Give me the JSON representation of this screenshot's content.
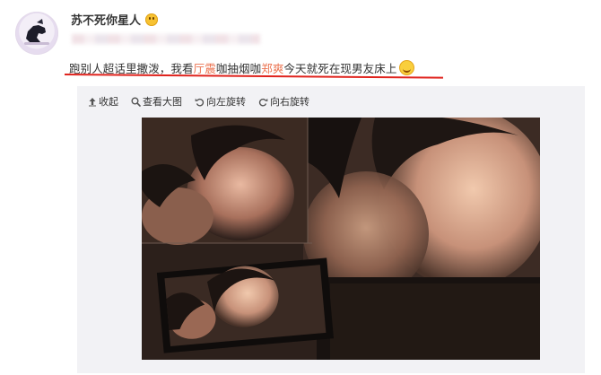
{
  "post": {
    "username": "苏不死你星人",
    "text_parts": {
      "p1": "跑别人超话里撒泼，我看",
      "h1": "厅震",
      "p2": "咖抽烟咖",
      "h2": "郑爽",
      "p3": "今天就死在现男友床上"
    }
  },
  "toolbar": {
    "collapse_label": "收起",
    "view_large_label": "查看大图",
    "rotate_left_label": "向左旋转",
    "rotate_right_label": "向右旋转"
  },
  "colors": {
    "highlight": "#eb7350",
    "underline": "#e0231d",
    "text": "#333333",
    "media_bg": "#f2f2f5"
  },
  "icons": [
    "avatar",
    "emoji-icon",
    "smile-emoji-icon",
    "collapse-icon",
    "zoom-icon",
    "rotate-left-icon",
    "rotate-right-icon"
  ]
}
